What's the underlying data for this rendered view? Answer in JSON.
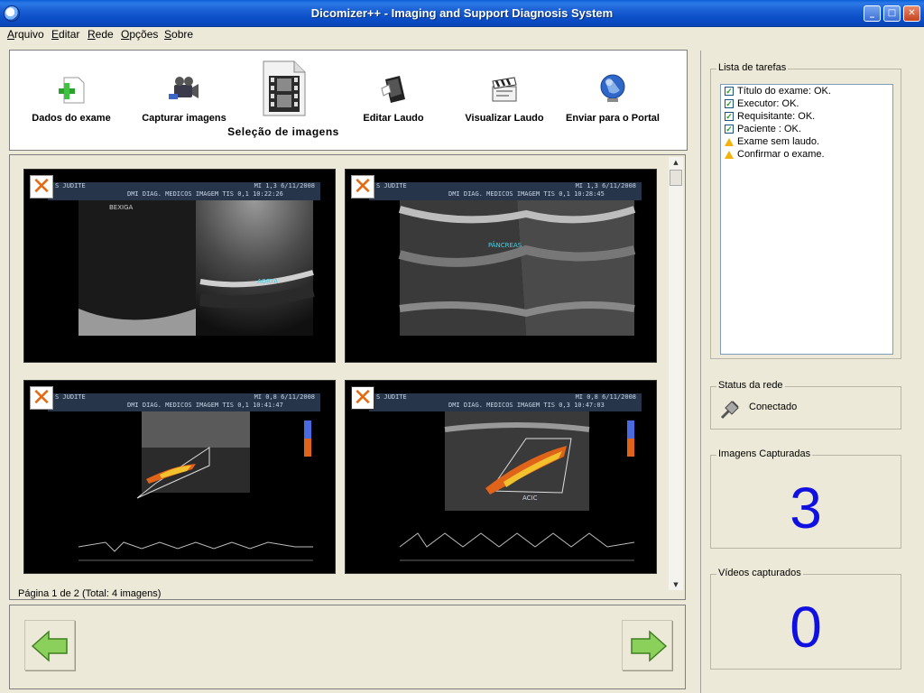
{
  "window": {
    "title": "Dicomizer++ - Imaging and Support Diagnosis System",
    "controls": [
      "minimize",
      "maximize",
      "close"
    ]
  },
  "menu": {
    "items": [
      "Arquivo",
      "Editar",
      "Rede",
      "Opções",
      "Sobre"
    ]
  },
  "toolbar": {
    "items": [
      {
        "label": "Dados do exame",
        "icon": "add-document-icon"
      },
      {
        "label": "Capturar imagens",
        "icon": "camcorder-icon"
      },
      {
        "label": "Seleção de imagens",
        "icon": "film-strip-icon",
        "active": true
      },
      {
        "label": "Editar Laudo",
        "icon": "edit-report-icon"
      },
      {
        "label": "Visualizar Laudo",
        "icon": "clapperboard-icon"
      },
      {
        "label": "Enviar para o Portal",
        "icon": "globe-icon"
      }
    ]
  },
  "gallery": {
    "page_info": "Página 1 de 2 (Total: 4 imagens)",
    "images": [
      {
        "header_left": "S  JUDITE",
        "header_right": "MI 1,3   6/11/2008",
        "header_sub": "DMI DIAG. MEDICOS IMAGEM  TIS 0,1  10:22:26",
        "labels": [
          "BEXIGA",
          "AORTA"
        ]
      },
      {
        "header_left": "S  JUDITE",
        "header_right": "MI 1,3   6/11/2008",
        "header_sub": "DMI DIAG. MEDICOS IMAGEM  TIS 0,1  10:28:45",
        "labels": [
          "PÂNCREAS"
        ]
      },
      {
        "header_left": "S  JUDITE",
        "header_right": "MI 0,8   6/11/2008",
        "header_sub": "DMI DIAG. MEDICOS IMAGEM  TIS 0,1  10:41:47",
        "labels": []
      },
      {
        "header_left": "S  JUDITE",
        "header_right": "MI 0,8   6/11/2008",
        "header_sub": "DMI DIAG. MEDICOS IMAGEM  TIS 0,3  10:47:03",
        "labels": [
          "ACIC"
        ]
      }
    ]
  },
  "tasks": {
    "title": "Lista de tarefas",
    "items": [
      {
        "text": "Título do exame: OK.",
        "status": "ok"
      },
      {
        "text": "Executor: OK.",
        "status": "ok"
      },
      {
        "text": "Requisitante: OK.",
        "status": "ok"
      },
      {
        "text": "Paciente : OK.",
        "status": "ok"
      },
      {
        "text": "Exame sem laudo.",
        "status": "warning"
      },
      {
        "text": "Confirmar o exame.",
        "status": "warning"
      }
    ]
  },
  "network": {
    "title": "Status da rede",
    "status": "Conectado",
    "icon": "network-cable-icon"
  },
  "captured_images": {
    "title": "Imagens Capturadas",
    "count": "3"
  },
  "captured_videos": {
    "title": "Vídeos capturados",
    "count": "0"
  },
  "navigation": {
    "prev_icon": "arrow-left-icon",
    "next_icon": "arrow-right-icon"
  },
  "colors": {
    "titlebar": "#0b4ec7",
    "counter": "#1010e0",
    "delete_x": "#e46a12",
    "nav_arrow": "#8bd05a"
  }
}
